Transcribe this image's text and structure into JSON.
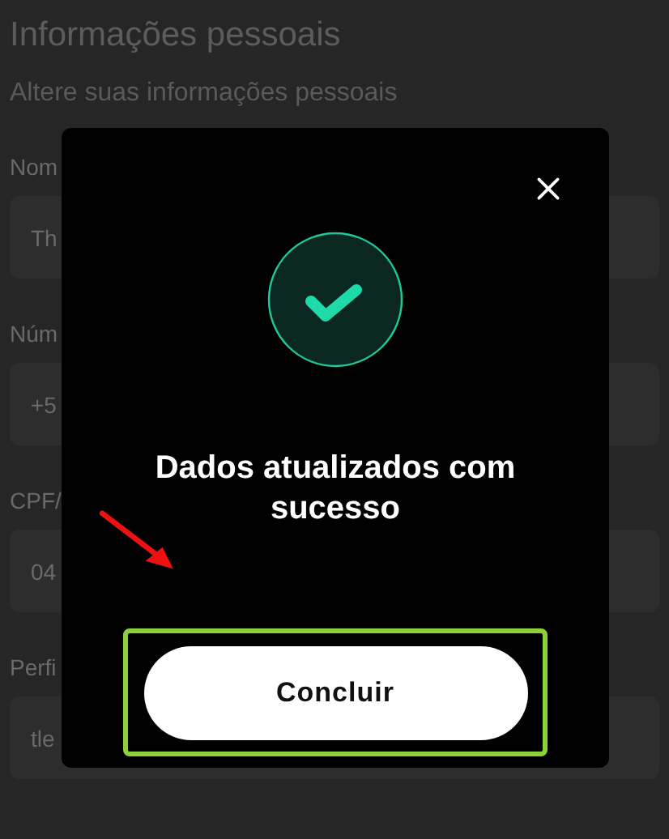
{
  "page": {
    "title": "Informações pessoais",
    "subtitle": "Altere suas informações pessoais",
    "fields": [
      {
        "label": "Nom",
        "value": "Th"
      },
      {
        "label": "Núm",
        "value": "+5"
      },
      {
        "label": "CPF/",
        "value": "04"
      },
      {
        "label": "Perfi",
        "value": "tle"
      }
    ]
  },
  "modal": {
    "message": "Dados atualizados com sucesso",
    "button": "Concluir"
  }
}
